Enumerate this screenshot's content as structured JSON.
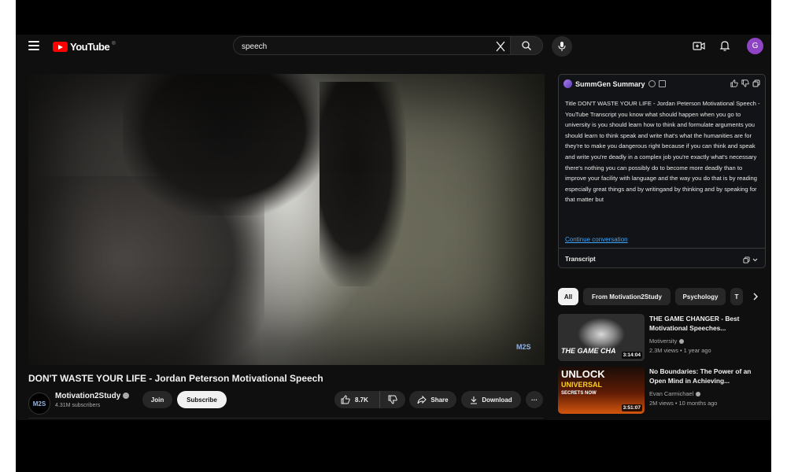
{
  "header": {
    "logo_text": "YouTube",
    "logo_sup": "®",
    "search_value": "speech",
    "avatar_letter": "G"
  },
  "video": {
    "title": "DON'T WASTE YOUR LIFE - Jordan Peterson Motivational Speech",
    "watermark": "M2S",
    "channel_name": "Motivation2Study",
    "channel_avatar_text": "M2S",
    "subscribers": "4.31M subscribers",
    "join_label": "Join",
    "subscribe_label": "Subscribe",
    "likes": "8.7K",
    "share_label": "Share",
    "download_label": "Download",
    "more_label": "···"
  },
  "summary": {
    "title": "SummGen Summary",
    "body": "Title DON'T WASTE YOUR LIFE - Jordan Peterson Motivational Speech - YouTube Transcript you know what should happen when you go to university is you should learn how to think and formulate arguments you should learn to think speak and write that's what the humanities are for they're to make you dangerous right because if you can think and speak and write you're deadly in a complex job you're exactly what's necessary there's nothing you can possibly do to become more deadly than to improve your facility with language and the way you do that is by reading especially great things and by writingand by thinking and by speaking for that matter but",
    "continue_link": "Continue conversation",
    "transcript_label": "Transcript"
  },
  "chips": [
    "All",
    "From Motivation2Study",
    "Psychology",
    "T"
  ],
  "recommendations": [
    {
      "title": "THE GAME CHANGER - Best Motivational Speeches...",
      "channel": "Motiversity",
      "views": "2.3M views",
      "age": "1 year ago",
      "duration": "3:14:04",
      "thumb_text": "THE GAME CHA"
    },
    {
      "title": "No Boundaries: The Power of an Open Mind in Achieving...",
      "channel": "Evan Carmichael",
      "views": "2M views",
      "age": "10 months ago",
      "duration": "3:51:07",
      "thumb_line1": "UNLOCK",
      "thumb_line2": "UNIVERSAL",
      "thumb_line3": "SECRETS NOW"
    }
  ],
  "colors": {
    "youtube_red": "#ff0000",
    "background": "#0f0f0f",
    "link_blue": "#3ea6ff",
    "avatar_purple": "#8e44c4"
  }
}
